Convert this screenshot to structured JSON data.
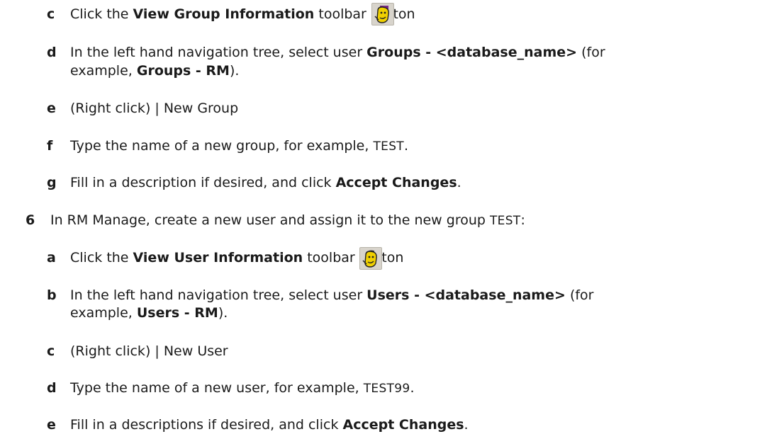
{
  "substeps_top": [
    {
      "label": "c",
      "parts": [
        "Click the ",
        "View Group Information",
        " toolbar button"
      ]
    },
    {
      "label": "d",
      "line1": [
        "In the left hand navigation tree, select user ",
        "Groups - <database_name>",
        " (for"
      ],
      "line2": [
        "example, ",
        "Groups - RM",
        ")."
      ]
    },
    {
      "label": "e",
      "text": "(Right click) | New Group"
    },
    {
      "label": "f",
      "parts": [
        "Type the name of a new group, for example, ",
        "TEST",
        "."
      ]
    },
    {
      "label": "g",
      "parts": [
        "Fill in a description if desired, and click ",
        "Accept Changes",
        "."
      ]
    }
  ],
  "step6": {
    "number": "6",
    "parts": [
      "In RM Manage, create a new user and assign it to the new group ",
      "TEST",
      ":"
    ]
  },
  "substeps_bottom": [
    {
      "label": "a",
      "parts": [
        "Click the ",
        "View User Information",
        " toolbar button"
      ]
    },
    {
      "label": "b",
      "line1": [
        "In the left hand navigation tree, select user ",
        "Users - <database_name>",
        " (for"
      ],
      "line2": [
        "example, ",
        "Users - RM",
        ")."
      ]
    },
    {
      "label": "c",
      "text": "(Right click) | New User"
    },
    {
      "label": "d",
      "parts": [
        "Type the name of a new user, for example, ",
        "TEST99",
        "."
      ]
    },
    {
      "label": "e",
      "parts": [
        "Fill in a descriptions if desired, and click ",
        "Accept Changes",
        "."
      ]
    }
  ],
  "icons": {
    "group_icon": "view-group-information-icon",
    "user_icon": "view-user-information-icon",
    "icon_bg": "#d8d4cc",
    "face_color": "#f0d000"
  }
}
